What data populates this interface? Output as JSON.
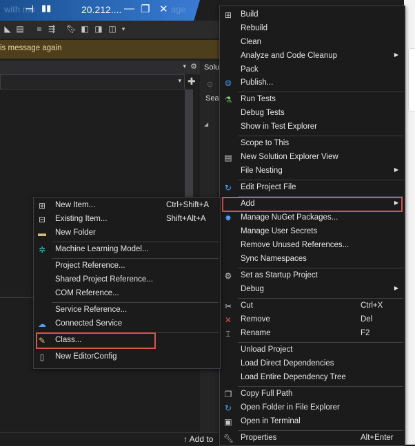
{
  "window": {
    "title": "20.212....",
    "title_faint_left": "with mu",
    "title_faint_right": "age"
  },
  "infobar": {
    "text": "is message again"
  },
  "solution_panel": {
    "tab_label": "Solu",
    "search_label": "Sear"
  },
  "status": {
    "add_to_label": "Add to"
  },
  "context_menu": {
    "items": [
      {
        "label": "Build",
        "icon": "build-icon"
      },
      {
        "label": "Rebuild"
      },
      {
        "label": "Clean"
      },
      {
        "label": "Analyze and Code Cleanup",
        "submenu": true
      },
      {
        "label": "Pack"
      },
      {
        "label": "Publish...",
        "icon": "globe-icon"
      },
      {
        "label": "Run Tests",
        "icon": "run-tests-icon"
      },
      {
        "label": "Debug Tests"
      },
      {
        "label": "Show in Test Explorer"
      },
      {
        "label": "Scope to This"
      },
      {
        "label": "New Solution Explorer View",
        "icon": "new-view-icon"
      },
      {
        "label": "File Nesting",
        "submenu": true
      },
      {
        "label": "Edit Project File",
        "icon": "refresh-icon"
      },
      {
        "label": "Add",
        "submenu": true
      },
      {
        "label": "Manage NuGet Packages...",
        "icon": "nuget-icon"
      },
      {
        "label": "Manage User Secrets"
      },
      {
        "label": "Remove Unused References..."
      },
      {
        "label": "Sync Namespaces"
      },
      {
        "label": "Set as Startup Project",
        "icon": "gear-icon"
      },
      {
        "label": "Debug",
        "submenu": true
      },
      {
        "label": "Cut",
        "shortcut": "Ctrl+X",
        "icon": "scissors-icon"
      },
      {
        "label": "Remove",
        "shortcut": "Del",
        "icon": "remove-x-icon"
      },
      {
        "label": "Rename",
        "shortcut": "F2",
        "icon": "rename-icon"
      },
      {
        "label": "Unload Project"
      },
      {
        "label": "Load Direct Dependencies"
      },
      {
        "label": "Load Entire Dependency Tree"
      },
      {
        "label": "Copy Full Path",
        "icon": "copy-icon"
      },
      {
        "label": "Open Folder in File Explorer",
        "icon": "refresh-icon"
      },
      {
        "label": "Open in Terminal",
        "icon": "terminal-icon"
      },
      {
        "label": "Properties",
        "shortcut": "Alt+Enter",
        "icon": "wrench-icon"
      }
    ]
  },
  "add_submenu": {
    "items": [
      {
        "label": "New Item...",
        "shortcut": "Ctrl+Shift+A",
        "icon": "new-item-icon"
      },
      {
        "label": "Existing Item...",
        "shortcut": "Shift+Alt+A",
        "icon": "existing-item-icon"
      },
      {
        "label": "New Folder",
        "icon": "folder-icon"
      },
      {
        "label": "Machine Learning Model...",
        "icon": "ml-model-icon"
      },
      {
        "label": "Project Reference..."
      },
      {
        "label": "Shared Project Reference..."
      },
      {
        "label": "COM Reference..."
      },
      {
        "label": "Service Reference..."
      },
      {
        "label": "Connected Service",
        "icon": "connected-service-icon"
      },
      {
        "label": "Class...",
        "icon": "class-icon"
      },
      {
        "label": "New EditorConfig",
        "icon": "editorconfig-icon"
      }
    ]
  },
  "colors": {
    "menu_bg": "#1b1b1c",
    "highlight_border": "#d9534f",
    "accent_blue": "#2f6fc0"
  }
}
